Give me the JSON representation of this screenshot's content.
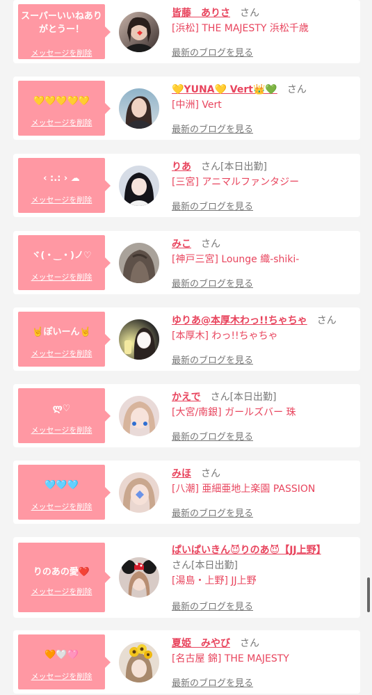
{
  "delete_label": "メッセージを削除",
  "blog_label": "最新のブログを見る",
  "colors": {
    "bubble": "#ff98a3",
    "name": "#e8445d",
    "background": "#f4f4f4"
  },
  "cards": [
    {
      "message": "スーパーいいねありがとうー！",
      "name": "皆藤　ありさ",
      "suffix": "さん",
      "shop": "[浜松] THE MAJESTY 浜松千歳"
    },
    {
      "message": "💛💛💛💛💛",
      "name": "💛YUNA💛 Vert👑💚",
      "suffix": "さん",
      "shop": "[中洲] Vert"
    },
    {
      "message": "‹ :.: › ☁",
      "name": "りあ",
      "suffix": "さん[本日出勤]",
      "shop": "[三宮] アニマルファンタジー"
    },
    {
      "message": "ヾ(・‿・)ノ♡",
      "name": "みこ",
      "suffix": "さん",
      "shop": "[神戸三宮] Lounge 織-shiki-"
    },
    {
      "message": "🤘ぽいーん🤘",
      "name": "ゆりあ@本厚木わっ!!ちゃちゃ",
      "suffix": "さん",
      "shop": "[本厚木] わっ!!ちゃちゃ"
    },
    {
      "message": "ლ♡",
      "name": "かえで",
      "suffix": "さん[本日出勤]",
      "shop": "[大宮/南銀] ガールズバー 珠"
    },
    {
      "message": "🩵🩵🩵",
      "name": "みほ",
      "suffix": "さん",
      "shop": "[八潮] 亜細亜地上楽園 PASSION"
    },
    {
      "message": "りのあの愛❤️",
      "name": "ぱいぱいきん😈りのあ😈【JJ上野】",
      "suffix": "さん[本日出勤]",
      "shop": "[湯島・上野] JJ上野"
    },
    {
      "message": "🧡🤍🩷",
      "name": "夏姫　みやび",
      "suffix": "さん",
      "shop": "[名古屋 錦] THE MAJESTY"
    }
  ]
}
